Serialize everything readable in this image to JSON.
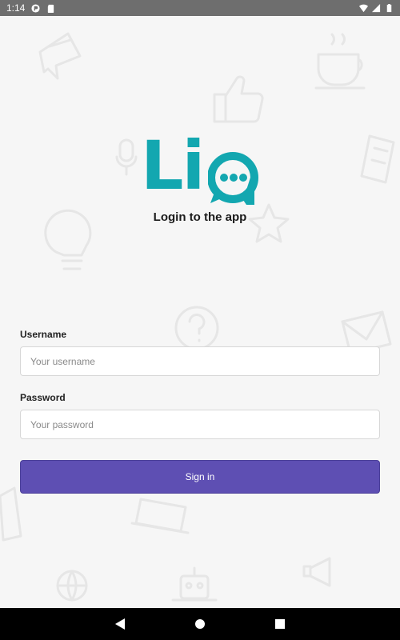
{
  "status_bar": {
    "time": "1:14"
  },
  "logo": {
    "text": "Li",
    "colors": {
      "brand": "#13a7b0"
    }
  },
  "login": {
    "subtitle": "Login to the app",
    "username_label": "Username",
    "username_placeholder": "Your username",
    "password_label": "Password",
    "password_placeholder": "Your password",
    "signin_label": "Sign in",
    "colors": {
      "button": "#5e4fb3"
    }
  },
  "nav_bar": {
    "icons": [
      "back-icon",
      "home-icon",
      "recents-icon"
    ]
  }
}
